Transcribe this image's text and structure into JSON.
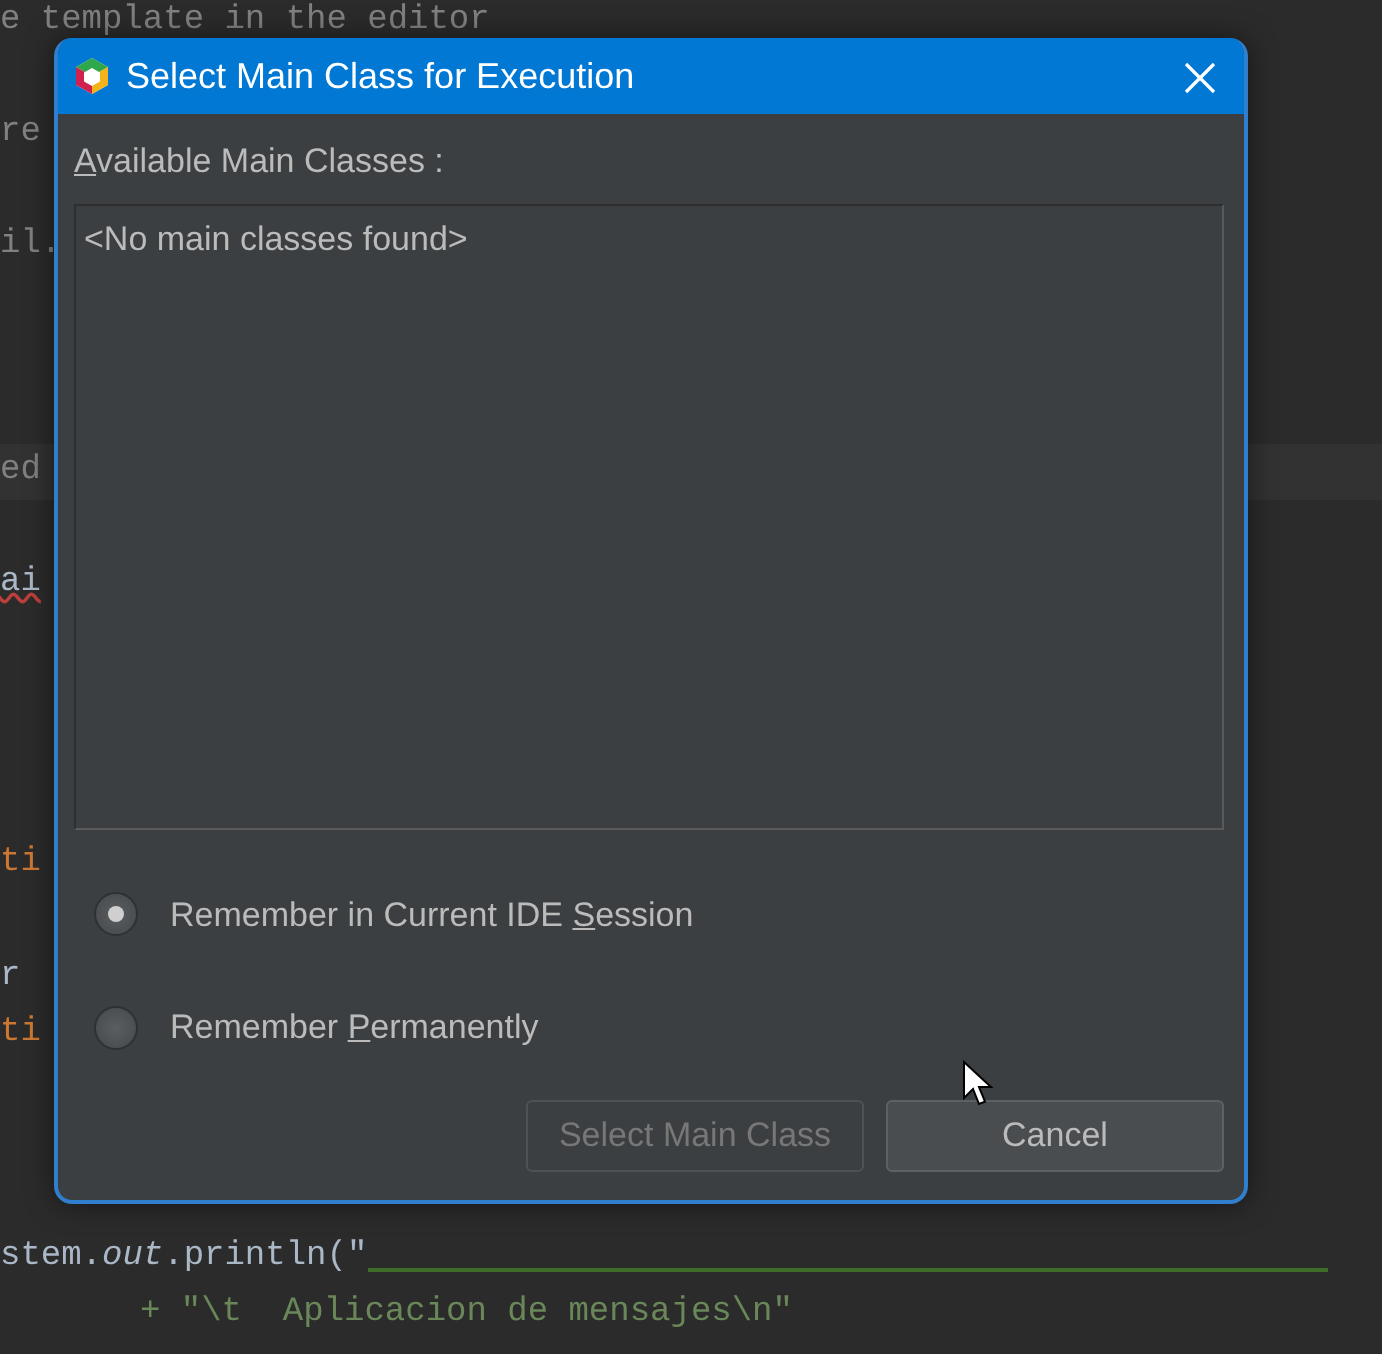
{
  "editor": {
    "lines": [
      {
        "text": "e template in the editor",
        "kind": "comment"
      },
      {
        "text": "re",
        "kind": "comment"
      },
      {
        "text": "il.",
        "kind": "comment"
      },
      {
        "text": "ed",
        "kind": "current"
      },
      {
        "text": "ai",
        "kind": "error"
      },
      {
        "text": "ti",
        "kind": "keyword"
      },
      {
        "text": "r",
        "kind": "plain"
      },
      {
        "text": "ti",
        "kind": "keyword"
      },
      {
        "text": "stem.*out*.println(\"",
        "kind": "call"
      },
      {
        "text": "+ \"\\t  Aplicacion de mensajes\\n\"",
        "kind": "string"
      }
    ]
  },
  "dialog": {
    "title": "Select Main Class for Execution",
    "list_label": {
      "mnemonic": "A",
      "after": "vailable Main Classes :"
    },
    "list_items": [
      "<No main classes found>"
    ],
    "options": [
      {
        "before": "Remember in Current IDE ",
        "mnemonic": "S",
        "after": "ession",
        "selected": true
      },
      {
        "before": "Remember ",
        "mnemonic": "P",
        "after": "ermanently",
        "selected": false
      }
    ],
    "buttons": [
      {
        "label": "Select Main Class",
        "disabled": true
      },
      {
        "label": "Cancel",
        "disabled": false
      }
    ]
  }
}
